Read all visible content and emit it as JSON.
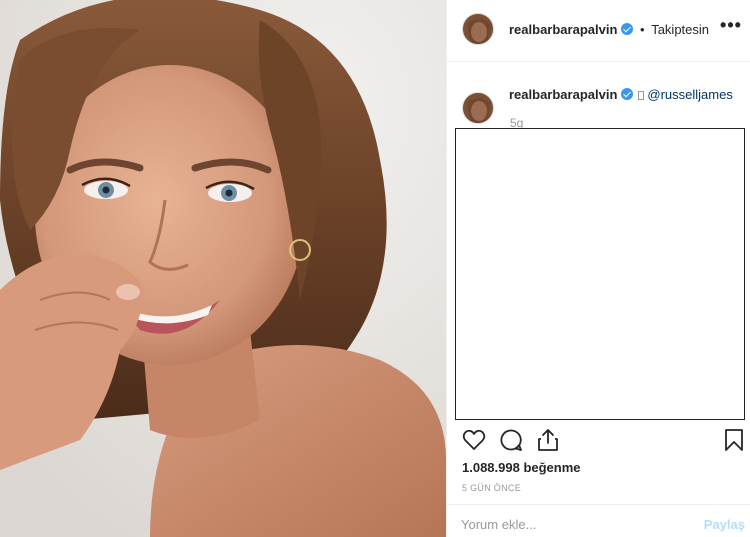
{
  "post": {
    "username": "realbarbarapalvin",
    "follow_separator": "•",
    "follow_label": "Takiptesin",
    "more_label": "•••",
    "comment": {
      "username": "realbarbarapalvin",
      "mention": "@russelljames",
      "time": "5g"
    },
    "likes_text": "1.088.998 beğenme",
    "age_text": "5 GÜN ÖNCE",
    "comment_placeholder": "Yorum ekle...",
    "post_button": "Paylaş"
  },
  "colors": {
    "verified": "#3897f0",
    "link": "#003569",
    "post_disabled": "#b2dffc",
    "muted": "#999999"
  },
  "icons": {
    "like": "heart-icon",
    "comment": "comment-bubble-icon",
    "share": "share-icon",
    "save": "bookmark-icon",
    "more": "more-options-icon",
    "verified": "verified-badge-icon"
  }
}
